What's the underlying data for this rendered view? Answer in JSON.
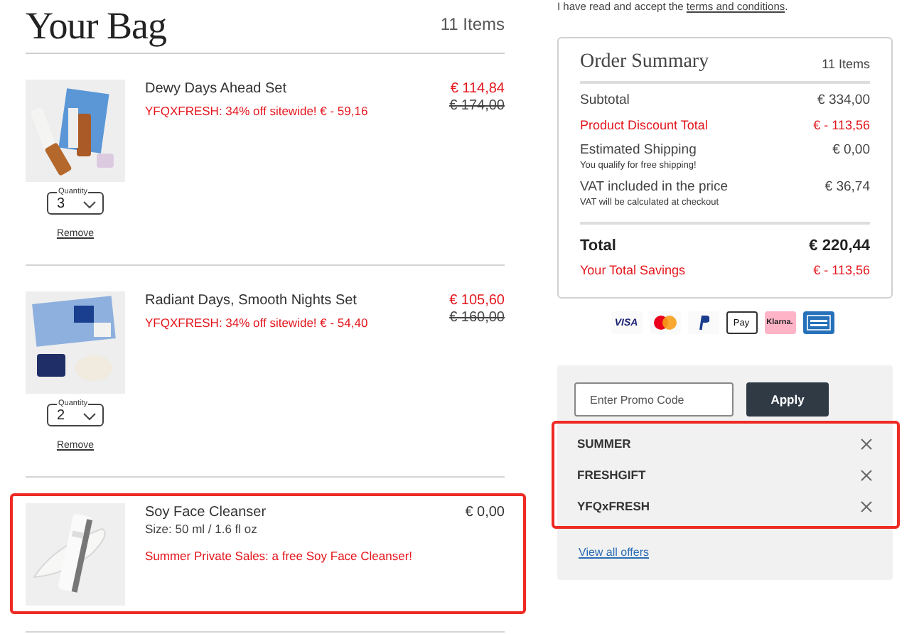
{
  "terms_notice": {
    "text": "I have read and accept the",
    "link": "terms and conditions",
    "end": "."
  },
  "bag": {
    "title": "Your Bag",
    "count": "11 Items",
    "items": [
      {
        "name": "Dewy Days Ahead Set",
        "promo": "YFQXFRESH: 34% off sitewide! € - 59,16",
        "price": "€ 114,84",
        "old_price": "€ 174,00",
        "quantity_label": "Quantity",
        "quantity": "3",
        "remove": "Remove",
        "highlighted": false
      },
      {
        "name": "Radiant Days, Smooth Nights Set",
        "promo": "YFQXFRESH: 34% off sitewide! € - 54,40",
        "price": "€ 105,60",
        "old_price": "€ 160,00",
        "quantity_label": "Quantity",
        "quantity": "2",
        "remove": "Remove",
        "highlighted": false
      },
      {
        "name": "Soy Face Cleanser",
        "size": "Size: 50 ml / 1.6 fl oz",
        "promo": "Summer Private Sales: a free Soy Face Cleanser!",
        "price": "€ 0,00",
        "highlighted": true
      }
    ]
  },
  "summary": {
    "title": "Order Summary",
    "count": "11 Items",
    "rows": [
      {
        "kind": "regular",
        "label": "Subtotal",
        "value": "€ 334,00"
      },
      {
        "kind": "discount",
        "label": "Product Discount Total",
        "value": "€ - 113,56"
      },
      {
        "kind": "regular",
        "label": "Estimated Shipping",
        "value": "€ 0,00",
        "note": "You qualify for free shipping!"
      },
      {
        "kind": "regular",
        "label": "VAT included in the price",
        "value": "€ 36,74",
        "note": "VAT will be calculated at checkout"
      },
      {
        "kind": "total",
        "label": "Total",
        "value": "€ 220,44"
      },
      {
        "kind": "discount",
        "label": "Your Total Savings",
        "value": "€ - 113,56"
      }
    ]
  },
  "payment_methods": [
    {
      "kind": "visa",
      "label": "VISA"
    },
    {
      "kind": "mastercard"
    },
    {
      "kind": "paypal"
    },
    {
      "kind": "applepay",
      "label": "Pay"
    },
    {
      "kind": "klarna",
      "label": "Klarna."
    },
    {
      "kind": "amex"
    }
  ],
  "promo": {
    "placeholder": "Enter Promo Code",
    "button": "Apply",
    "highlighted": true,
    "codes": [
      "SUMMER",
      "FRESHGIFT",
      "YFQxFRESH"
    ],
    "link": "View all offers"
  }
}
